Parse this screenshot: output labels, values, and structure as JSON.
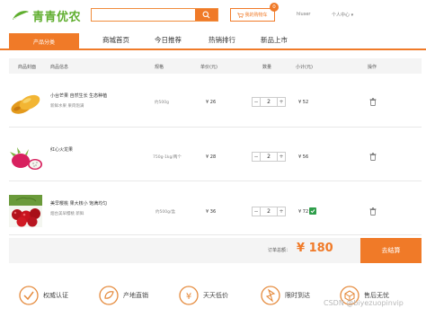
{
  "brand": {
    "name": "青青优农",
    "color": "#5fae2e"
  },
  "accent_color": "#f07a28",
  "search": {
    "placeholder": "",
    "icon": "search-icon"
  },
  "header": {
    "cart_label": "我的购物车",
    "cart_count": "0",
    "user_name": "hluser",
    "user_center": "个人中心 ▾"
  },
  "nav": {
    "category_label": "产品分类",
    "items": [
      {
        "label": "商城首页"
      },
      {
        "label": "今日推荐"
      },
      {
        "label": "热销排行"
      },
      {
        "label": "新品上市"
      }
    ]
  },
  "table": {
    "headers": [
      "商品封面",
      "商品信息",
      "规格",
      "单价(元)",
      "数量",
      "小计(元)",
      "操作"
    ],
    "rows": [
      {
        "name": "小台芒果 自然生长 生态种植",
        "sub": "新鲜水果 果肉饱满",
        "spec": "约500g",
        "price": "¥ 26",
        "qty": "2",
        "subtotal": "¥ 52",
        "image": "mango"
      },
      {
        "name": "红心火龙果",
        "sub": "",
        "spec": "750g-1kg/两个",
        "price": "¥ 28",
        "qty": "2",
        "subtotal": "¥ 56",
        "image": "dragon-fruit"
      },
      {
        "name": "美早樱桃 果大核小 饱满均匀",
        "sub": "烟台美早樱桃 新鲜",
        "spec": "约500g/盒",
        "price": "¥ 36",
        "qty": "2",
        "subtotal": "¥ 72",
        "image": "cherry"
      }
    ]
  },
  "summary": {
    "total_label": "订单总额：",
    "total_value": "¥ 180",
    "checkout_label": "去结算"
  },
  "services": [
    {
      "label": "权威认证",
      "icon": "certified-icon"
    },
    {
      "label": "产地直销",
      "icon": "origin-icon"
    },
    {
      "label": "天天低价",
      "icon": "price-icon"
    },
    {
      "label": "限时到达",
      "icon": "delivery-icon"
    },
    {
      "label": "售后无忧",
      "icon": "aftersale-icon"
    }
  ],
  "watermark": "CSDN @biyezuopinvip"
}
